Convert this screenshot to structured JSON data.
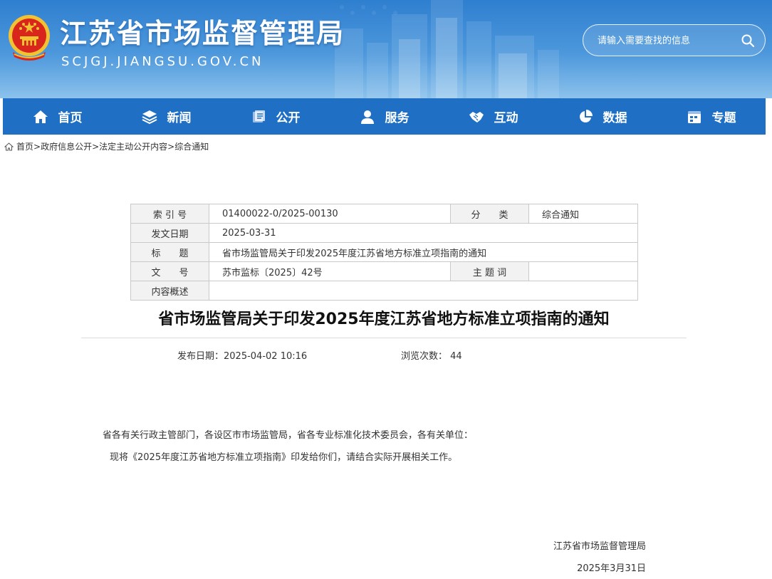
{
  "header": {
    "site_title": "江苏省市场监督管理局",
    "site_domain": "SCJGJ.JIANGSU.GOV.CN",
    "search_placeholder": "请输入需要查找的信息"
  },
  "nav": {
    "items": [
      {
        "label": "首页",
        "icon": "home-icon"
      },
      {
        "label": "新闻",
        "icon": "layers-icon"
      },
      {
        "label": "公开",
        "icon": "document-stack-icon"
      },
      {
        "label": "服务",
        "icon": "user-icon"
      },
      {
        "label": "互动",
        "icon": "handshake-icon"
      },
      {
        "label": "数据",
        "icon": "pie-chart-icon"
      },
      {
        "label": "专题",
        "icon": "calendar-icon"
      }
    ]
  },
  "breadcrumb": {
    "items": [
      "首页",
      "政府信息公开",
      "法定主动公开内容",
      "综合通知"
    ],
    "separator": ">"
  },
  "info_table": {
    "index_label": "索 引 号",
    "index_value": "01400022-0/2025-00130",
    "category_label": "分　　类",
    "category_value": "综合通知",
    "issue_date_label": "发文日期",
    "issue_date_value": "2025-03-31",
    "title_label": "标　　题",
    "title_value": "省市场监管局关于印发2025年度江苏省地方标准立项指南的通知",
    "doc_no_label": "文　　号",
    "doc_no_value": "苏市监标〔2025〕42号",
    "subject_label": "主 题 词",
    "subject_value": "",
    "summary_label": "内容概述",
    "summary_value": ""
  },
  "article": {
    "title": "省市场监管局关于印发2025年度江苏省地方标准立项指南的通知",
    "publish_label": "发布日期：",
    "publish_value": "2025-04-02 10:16",
    "views_label": "浏览次数：",
    "views_value": "44",
    "paragraphs": [
      "省各有关行政主管部门，各设区市市场监管局，省各专业标准化技术委员会，各有关单位：",
      "现将《2025年度江苏省地方标准立项指南》印发给你们，请结合实际开展相关工作。"
    ],
    "signature_org": "江苏省市场监督管理局",
    "signature_date": "2025年3月31日"
  },
  "colors": {
    "nav_bg": "#1f6fc5",
    "header_top": "#2f7fd0",
    "emblem_red": "#d8261c",
    "emblem_gold": "#f3c233"
  }
}
